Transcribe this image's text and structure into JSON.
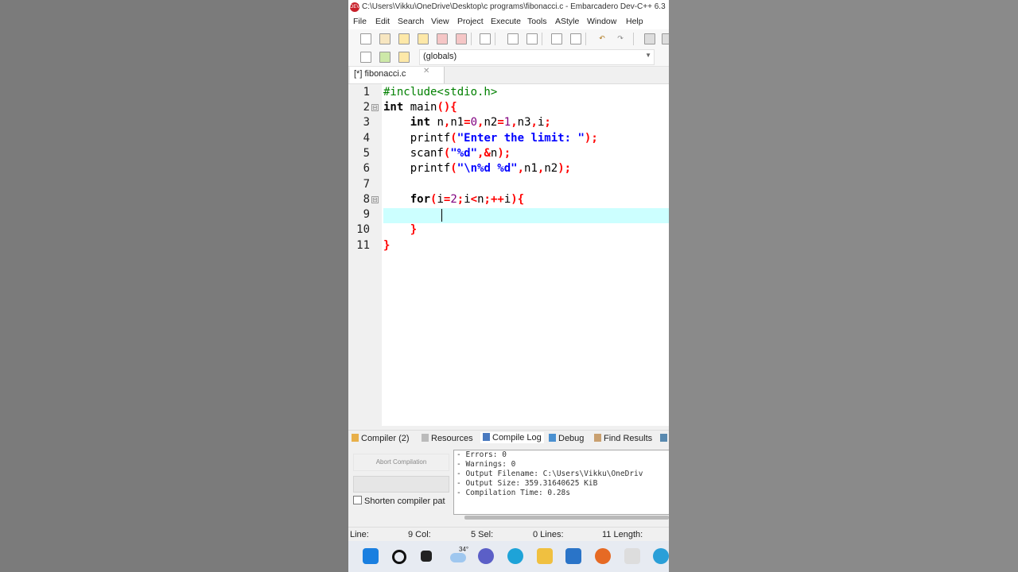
{
  "window": {
    "title": "C:\\Users\\Vikku\\OneDrive\\Desktop\\c programs\\fibonacci.c - Embarcadero Dev-C++ 6.3",
    "icon_text": "DEV"
  },
  "menu": [
    "File",
    "Edit",
    "Search",
    "View",
    "Project",
    "Execute",
    "Tools",
    "AStyle",
    "Window",
    "Help"
  ],
  "toolbar2": {
    "scope_select": "(globals)"
  },
  "tab": {
    "label": "[*] fibonacci.c",
    "close": "✕"
  },
  "editor": {
    "line_numbers": [
      "1",
      "2",
      "3",
      "4",
      "5",
      "6",
      "7",
      "8",
      "9",
      "10",
      "11"
    ],
    "fold_marks": [
      "⊟",
      "⊟"
    ],
    "current_line": 9,
    "lines": [
      [
        {
          "t": "#include<stdio.h>",
          "c": "pp"
        }
      ],
      [
        {
          "t": "int",
          "c": "kw"
        },
        {
          "t": " main",
          "c": ""
        },
        {
          "t": "(){",
          "c": "sym"
        }
      ],
      [
        {
          "t": "    ",
          "c": ""
        },
        {
          "t": "int",
          "c": "kw"
        },
        {
          "t": " n",
          "c": ""
        },
        {
          "t": ",",
          "c": "sym"
        },
        {
          "t": "n1",
          "c": ""
        },
        {
          "t": "=",
          "c": "sym"
        },
        {
          "t": "0",
          "c": "num"
        },
        {
          "t": ",",
          "c": "sym"
        },
        {
          "t": "n2",
          "c": ""
        },
        {
          "t": "=",
          "c": "sym"
        },
        {
          "t": "1",
          "c": "num"
        },
        {
          "t": ",",
          "c": "sym"
        },
        {
          "t": "n3",
          "c": ""
        },
        {
          "t": ",",
          "c": "sym"
        },
        {
          "t": "i",
          "c": ""
        },
        {
          "t": ";",
          "c": "sym"
        }
      ],
      [
        {
          "t": "    printf",
          "c": ""
        },
        {
          "t": "(",
          "c": "sym"
        },
        {
          "t": "\"Enter the limit: \"",
          "c": "str"
        },
        {
          "t": ");",
          "c": "sym"
        }
      ],
      [
        {
          "t": "    scanf",
          "c": ""
        },
        {
          "t": "(",
          "c": "sym"
        },
        {
          "t": "\"%d\"",
          "c": "str"
        },
        {
          "t": ",&",
          "c": "sym"
        },
        {
          "t": "n",
          "c": ""
        },
        {
          "t": ");",
          "c": "sym"
        }
      ],
      [
        {
          "t": "    printf",
          "c": ""
        },
        {
          "t": "(",
          "c": "sym"
        },
        {
          "t": "\"\\n%d %d\"",
          "c": "str"
        },
        {
          "t": ",",
          "c": "sym"
        },
        {
          "t": "n1",
          "c": ""
        },
        {
          "t": ",",
          "c": "sym"
        },
        {
          "t": "n2",
          "c": ""
        },
        {
          "t": ");",
          "c": "sym"
        }
      ],
      [
        {
          "t": "",
          "c": ""
        }
      ],
      [
        {
          "t": "    ",
          "c": ""
        },
        {
          "t": "for",
          "c": "kw"
        },
        {
          "t": "(",
          "c": "sym"
        },
        {
          "t": "i",
          "c": ""
        },
        {
          "t": "=",
          "c": "sym"
        },
        {
          "t": "2",
          "c": "num"
        },
        {
          "t": ";",
          "c": "sym"
        },
        {
          "t": "i",
          "c": ""
        },
        {
          "t": "<",
          "c": "sym"
        },
        {
          "t": "n",
          "c": ""
        },
        {
          "t": ";++",
          "c": "sym"
        },
        {
          "t": "i",
          "c": ""
        },
        {
          "t": "){",
          "c": "sym"
        }
      ],
      [
        {
          "t": "",
          "c": ""
        }
      ],
      [
        {
          "t": "    ",
          "c": ""
        },
        {
          "t": "}",
          "c": "sym"
        }
      ],
      [
        {
          "t": "}",
          "c": "sym"
        }
      ]
    ]
  },
  "bottom_tabs": [
    "Compiler (2)",
    "Resources",
    "Compile Log",
    "Debug",
    "Find Results"
  ],
  "compile_panel": {
    "abort_button": "Abort Compilation",
    "shorten_label": "Shorten compiler pat",
    "log_lines": [
      "- Errors: 0",
      "- Warnings: 0",
      "- Output Filename: C:\\Users\\Vikku\\OneDriv",
      "- Output Size: 359.31640625 KiB",
      "- Compilation Time: 0.28s"
    ]
  },
  "status": {
    "line_label": "Line:",
    "line_value": "9 Col:",
    "col_value": "5 Sel:",
    "sel_value": "0 Lines:",
    "lines_value": "11 Length:"
  },
  "taskbar": {
    "weather_temp": "34°"
  },
  "colors": {
    "current_line": "#ccffff",
    "keyword": "#000000",
    "string": "#0000ff",
    "symbol": "#ff0000",
    "number": "#800080",
    "preprocessor": "#008000"
  }
}
